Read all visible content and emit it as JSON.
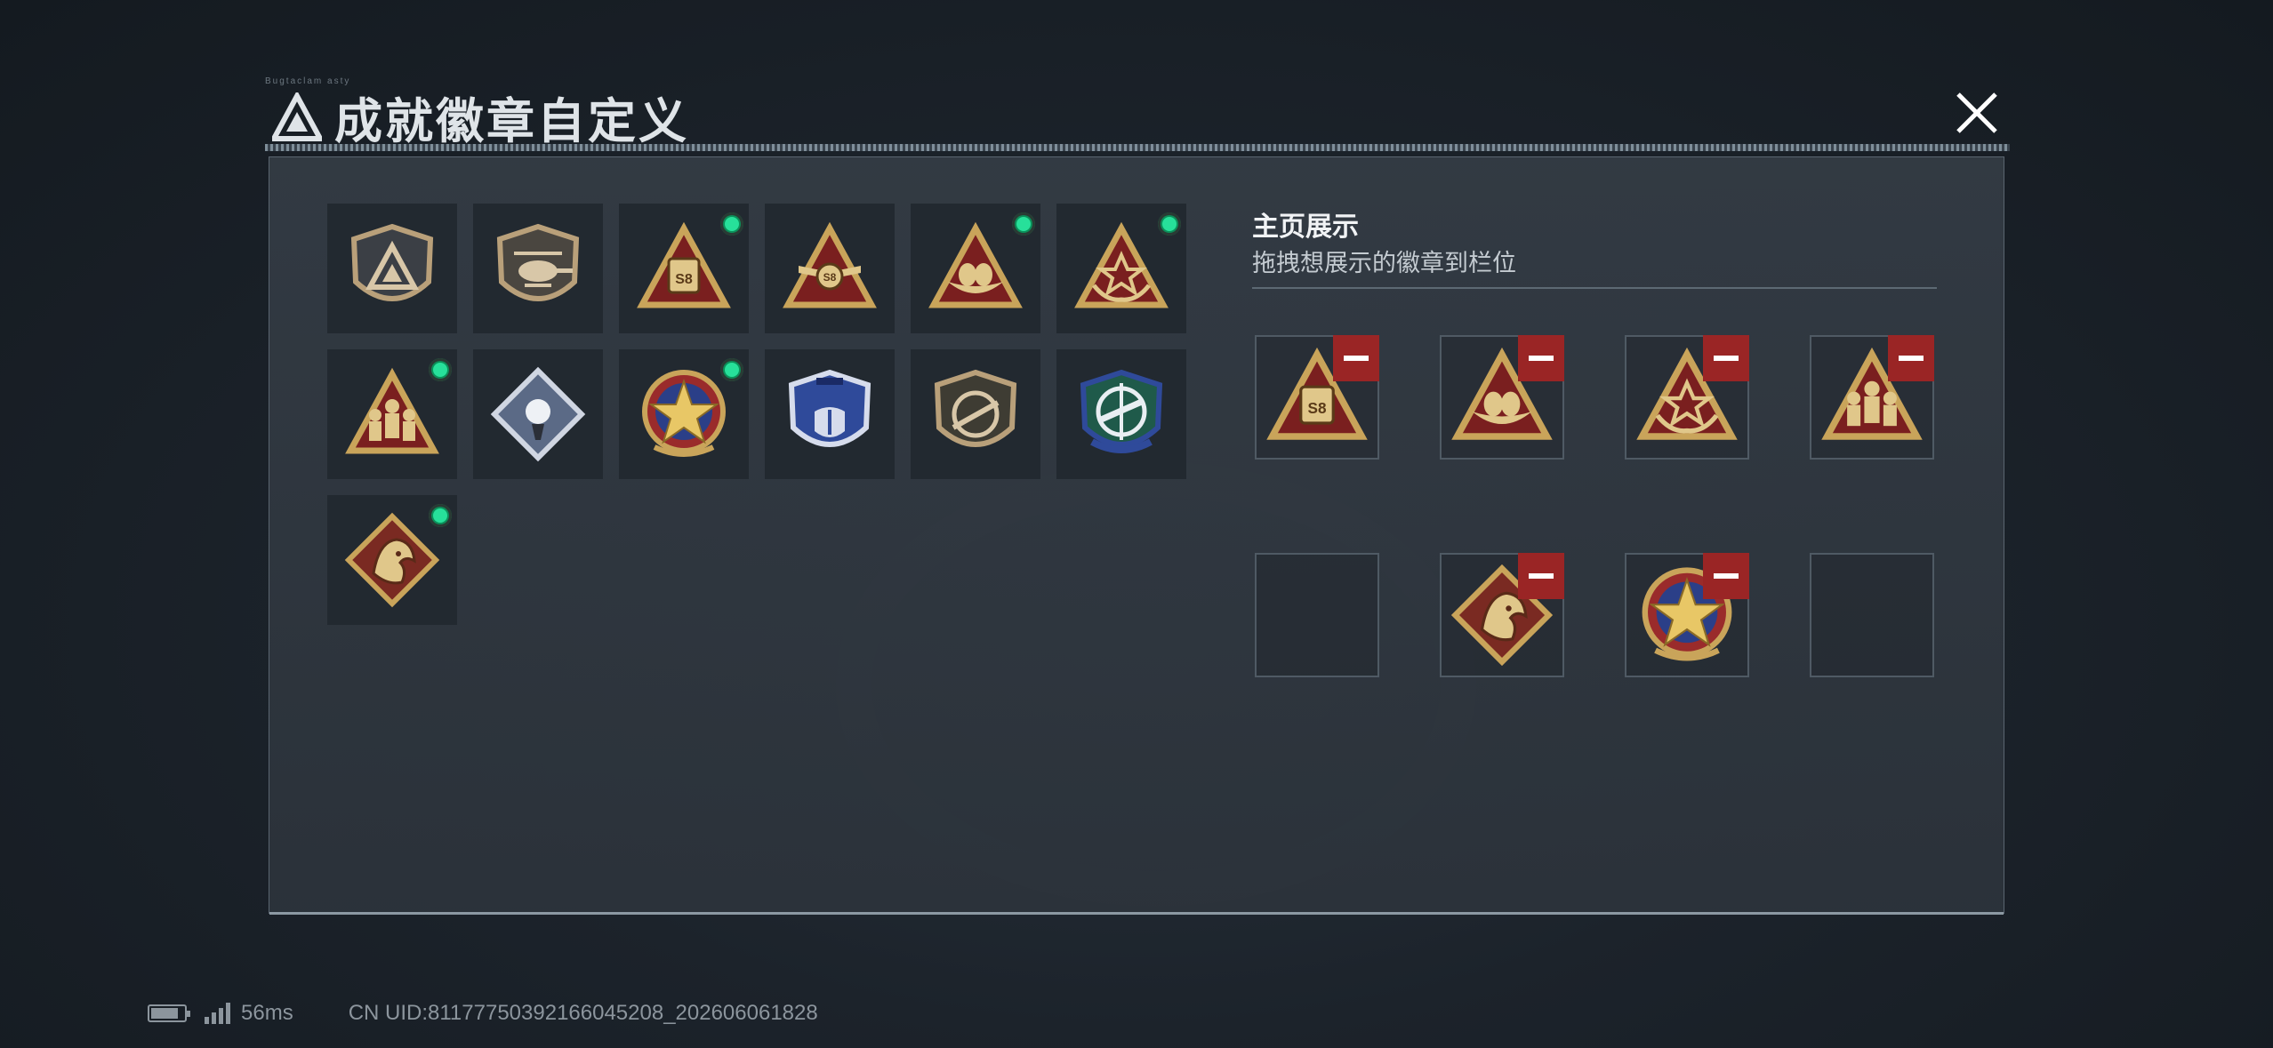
{
  "header": {
    "deco_text": "Bugtaclam asty",
    "title": "成就徽章自定义",
    "close_icon": "close-icon"
  },
  "badges": [
    {
      "icon": "triangle-shield-badge-icon",
      "new": false
    },
    {
      "icon": "helicopter-shield-badge-icon",
      "new": false
    },
    {
      "icon": "s8-triangle-badge-icon",
      "new": true
    },
    {
      "icon": "s8-winged-triangle-badge-icon",
      "new": false
    },
    {
      "icon": "eggs-triangle-badge-icon",
      "new": true
    },
    {
      "icon": "hands-star-triangle-badge-icon",
      "new": true
    },
    {
      "icon": "soldiers-triangle-badge-icon",
      "new": true
    },
    {
      "icon": "rose-diamond-badge-icon",
      "new": false
    },
    {
      "icon": "star-medal-badge-icon",
      "new": true
    },
    {
      "icon": "blue-wings-shield-badge-icon",
      "new": false
    },
    {
      "icon": "rifle-shield-badge-icon",
      "new": false
    },
    {
      "icon": "crosshair-shield-badge-icon",
      "new": false
    },
    {
      "icon": "dragon-diamond-badge-icon",
      "new": true
    }
  ],
  "showcase": {
    "title": "主页展示",
    "subtitle": "拖拽想展示的徽章到栏位",
    "slots": [
      {
        "icon": "s8-triangle-badge-icon",
        "filled": true
      },
      {
        "icon": "eggs-triangle-badge-icon",
        "filled": true
      },
      {
        "icon": "hands-star-triangle-badge-icon",
        "filled": true
      },
      {
        "icon": "soldiers-triangle-badge-icon",
        "filled": true
      },
      {
        "icon": "",
        "filled": false
      },
      {
        "icon": "dragon-diamond-badge-icon",
        "filled": true
      },
      {
        "icon": "star-medal-badge-icon",
        "filled": true
      },
      {
        "icon": "",
        "filled": false
      }
    ]
  },
  "footer": {
    "ping": "56ms",
    "uid": "CN UID:8117775039216604520​8_202606061828"
  },
  "colors": {
    "accent_green": "#27e09a",
    "remove_red": "#9a2525",
    "gold": "#c9a45a"
  }
}
